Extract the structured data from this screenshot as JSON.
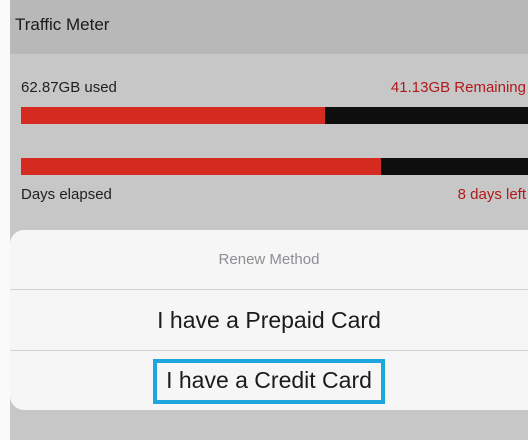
{
  "nav": {
    "title": "Traffic Meter"
  },
  "meter": {
    "data_used": "62.87GB used",
    "data_remaining": "41.13GB Remaining",
    "data_used_fraction": 0.6,
    "time_elapsed_fraction": 0.71,
    "days_elapsed_label": "Days elapsed",
    "days_left": "8 days left"
  },
  "action_sheet": {
    "title": "Renew Method",
    "options": [
      {
        "label": "I have a Prepaid Card"
      },
      {
        "label": "I have a Credit Card"
      }
    ]
  },
  "colors": {
    "bar_fill": "#d52a1f",
    "bar_track": "#0e0e0e",
    "remaining_text": "#b01a1a",
    "highlight": "#1ea7df"
  }
}
